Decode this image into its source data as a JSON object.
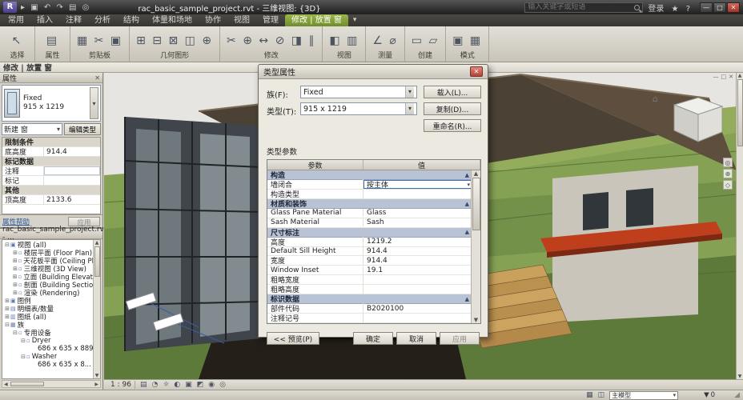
{
  "titlebar": {
    "title": "rac_basic_sample_project.rvt - 三维视图: {3D}",
    "search_placeholder": "输入关键字或短语",
    "login_label": "登录",
    "icons": {
      "open": "▸",
      "save": "▣",
      "undo": "↶",
      "redo": "↷",
      "print": "▤",
      "sync": "◎",
      "star": "★",
      "help": "?",
      "min": "—",
      "max": "□",
      "close": "✕"
    }
  },
  "ui": {
    "dropdown_arrow": "▾",
    "ribbon_toggle": "▾",
    "scroll_up": "▲",
    "scroll_down": "▼",
    "scroll_left": "◀",
    "scroll_right": "▶"
  },
  "ribbon": {
    "tabs": [
      {
        "label": "常用"
      },
      {
        "label": "插入"
      },
      {
        "label": "注释"
      },
      {
        "label": "分析"
      },
      {
        "label": "结构"
      },
      {
        "label": "体量和场地"
      },
      {
        "label": "协作"
      },
      {
        "label": "视图"
      },
      {
        "label": "管理"
      },
      {
        "label": "修改 | 放置 窗",
        "cls": "contextual"
      }
    ],
    "groups": [
      {
        "label": "选择",
        "glyphs": "↖"
      },
      {
        "label": "属性",
        "glyphs": "▤"
      },
      {
        "label": "剪贴板",
        "glyphs": "▦ ✂ ▣"
      },
      {
        "label": "几何图形",
        "glyphs": "⊞ ⊟ ⊠ ◫ ⊕"
      },
      {
        "label": "修改",
        "glyphs": "✂ ⊕ ↔ ⊘ ◨ ∥"
      },
      {
        "label": "视图",
        "glyphs": "◧ ▥"
      },
      {
        "label": "测量",
        "glyphs": "∠ ⌀"
      },
      {
        "label": "创建",
        "glyphs": "▭ ▱"
      },
      {
        "label": "模式",
        "glyphs": "▣ ▦"
      }
    ]
  },
  "options_bar": {
    "label": "修改 | 放置 窗"
  },
  "properties": {
    "title": "属性",
    "type_name": "Fixed",
    "type_size": "915 x 1219",
    "new_label": "新建 窗",
    "edit_type_label": "编辑类型",
    "rows": [
      {
        "cls": "group",
        "label": "限制条件"
      },
      {
        "label": "底高度",
        "value": "914.4"
      },
      {
        "cls": "group",
        "label": "标记数据"
      },
      {
        "cls": "editcell",
        "label": "注释",
        "value": ""
      },
      {
        "label": "标记",
        "value": ""
      },
      {
        "cls": "group",
        "label": "其他"
      },
      {
        "label": "顶高度",
        "value": "2133.6"
      }
    ],
    "help_label": "属性帮助",
    "apply_label": "应用"
  },
  "browser": {
    "title": "rac_basic_sample_project.rvt - ...",
    "items": [
      {
        "cls": "d0",
        "exp": "⊟",
        "icon": "▣",
        "label": "视图 (all)"
      },
      {
        "cls": "d1",
        "exp": "⊞",
        "icon": "▫",
        "label": "楼层平面 (Floor Plan)"
      },
      {
        "cls": "d1",
        "exp": "⊞",
        "icon": "▫",
        "label": "天花板平面 (Ceiling Plan)"
      },
      {
        "cls": "d1",
        "exp": "⊞",
        "icon": "▫",
        "label": "三维视图 (3D View)"
      },
      {
        "cls": "d1",
        "exp": "⊞",
        "icon": "▫",
        "label": "立面 (Building Elevation)"
      },
      {
        "cls": "d1",
        "exp": "⊞",
        "icon": "▫",
        "label": "剖面 (Building Section)"
      },
      {
        "cls": "d1",
        "exp": "⊞",
        "icon": "▫",
        "label": "渲染 (Rendering)"
      },
      {
        "cls": "d0",
        "exp": "⊞",
        "icon": "▣",
        "label": "图例"
      },
      {
        "cls": "d0",
        "exp": "⊞",
        "icon": "▤",
        "label": "明细表/数量"
      },
      {
        "cls": "d0",
        "exp": "⊞",
        "icon": "▥",
        "label": "图纸 (all)"
      },
      {
        "cls": "d0",
        "exp": "⊟",
        "icon": "▦",
        "label": "族"
      },
      {
        "cls": "d1",
        "exp": "⊟",
        "icon": "▫",
        "label": "专用设备"
      },
      {
        "cls": "d2",
        "exp": "⊟",
        "icon": "▫",
        "label": "Dryer"
      },
      {
        "cls": "d3",
        "exp": "",
        "icon": "",
        "label": "686 x 635 x 889"
      },
      {
        "cls": "d2",
        "exp": "⊟",
        "icon": "▫",
        "label": "Washer"
      },
      {
        "cls": "d3",
        "exp": "",
        "icon": "",
        "label": "686 x 635 x 8..."
      }
    ]
  },
  "dialog": {
    "title": "类型属性",
    "family_label": "族(F):",
    "family_value": "Fixed",
    "type_label": "类型(T):",
    "type_value": "915 x 1219",
    "load_label": "载入(L)...",
    "duplicate_label": "复制(D)...",
    "rename_label": "重命名(R)...",
    "type_params_label": "类型参数",
    "col_param": "参数",
    "col_value": "值",
    "rows": [
      {
        "cls": "group",
        "label": "构造",
        "pin": "▲"
      },
      {
        "cls": "editing",
        "label": "墙闭合",
        "value": "按主体"
      },
      {
        "label": "构造类型",
        "value": ""
      },
      {
        "cls": "group",
        "label": "材质和装饰",
        "pin": "▲"
      },
      {
        "label": "Glass Pane Material",
        "value": "Glass"
      },
      {
        "label": "Sash Material",
        "value": "Sash"
      },
      {
        "cls": "group",
        "label": "尺寸标注",
        "pin": "▲"
      },
      {
        "label": "高度",
        "value": "1219.2"
      },
      {
        "label": "Default Sill Height",
        "value": "914.4"
      },
      {
        "label": "宽度",
        "value": "914.4"
      },
      {
        "label": "Window Inset",
        "value": "19.1"
      },
      {
        "label": "粗略宽度",
        "value": ""
      },
      {
        "label": "粗略高度",
        "value": ""
      },
      {
        "cls": "group",
        "label": "标识数据",
        "pin": "▲"
      },
      {
        "label": "部件代码",
        "value": "B2020100"
      },
      {
        "label": "注释记号",
        "value": ""
      }
    ],
    "preview_label": "<< 预览(P)",
    "ok_label": "确定",
    "cancel_label": "取消",
    "apply_label": "应用"
  },
  "canvas": {
    "colors": {
      "terrain": "#85a154",
      "terrain_dark": "#5e7a3b",
      "roof": "#4b4134",
      "roof_light": "#5d4e3d",
      "canopy": "#bf3f1c",
      "pit": "#241f18",
      "timber": "#c9a15d",
      "wall": "#c9c5ba",
      "tower": "#3f454a"
    },
    "icons": {
      "home": "⌂",
      "steering_wheel": "◎",
      "zoom": "⊕",
      "rewind": "◇",
      "min": "—",
      "restore": "□",
      "close": "✕"
    }
  },
  "view_control_bar": {
    "scale": "1 : 96",
    "icons": {
      "detail_level": "▤",
      "visual_style": "◔",
      "sun_path": "☼",
      "shadows": "◐",
      "crop_view": "▣",
      "crop_visibility": "◩",
      "temporary_hide": "◉",
      "reveal_hidden": "◎"
    }
  },
  "status_bar": {
    "model_label": "主模型",
    "filter_count": "0",
    "icons": {
      "worksets": "▦",
      "design_options": "◫",
      "filter": "▼",
      "grip": "◢"
    }
  }
}
